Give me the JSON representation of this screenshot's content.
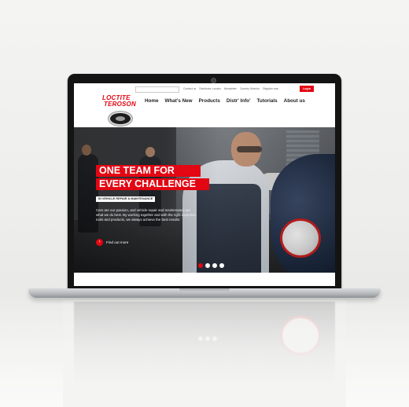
{
  "site": {
    "search": {
      "placeholder": ""
    },
    "utility_links": [
      "Contact us",
      "Distributor Locator",
      "Newsletter",
      "Country Selector",
      "Register now"
    ],
    "login_label": "Login",
    "logo": {
      "line1": "LOCTITE",
      "line2": "TEROSON"
    },
    "nav": [
      "Home",
      "What's New",
      "Products",
      "Distr' Info'",
      "Tutorials",
      "About us"
    ]
  },
  "hero": {
    "headline_line1": "ONE TEAM FOR",
    "headline_line2": "EVERY CHALLENGE",
    "subtag": "IN VEHICLE REPAIR & MAINTENANCE",
    "body": "Cars are our passion, and vehicle repair and maintenance are what we do best. By working together and with the right expertise, tools and products, we always achieve the best results.",
    "cta_label": "Find out more",
    "cta_icon": "chevron-right-icon",
    "carousel": {
      "count": 4,
      "active": 1
    }
  },
  "colors": {
    "brand_red": "#e30613",
    "bezel": "#141414",
    "background": "#f1f0ee"
  }
}
